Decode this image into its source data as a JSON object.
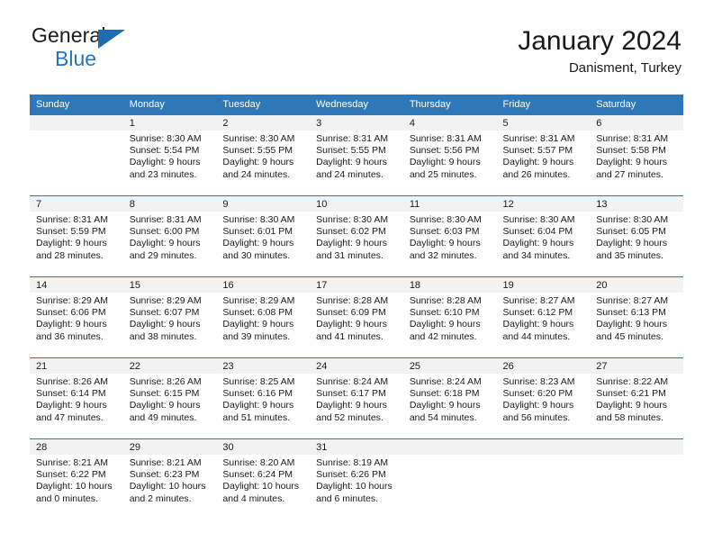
{
  "brand": {
    "name_part1": "General",
    "name_part2": "Blue"
  },
  "header": {
    "title": "January 2024",
    "subtitle": "Danisment, Turkey"
  },
  "colors": {
    "header_blue": "#3077b8",
    "brand_blue": "#1f77c4",
    "daynum_band": "#f2f2f2"
  },
  "weekdays": [
    "Sunday",
    "Monday",
    "Tuesday",
    "Wednesday",
    "Thursday",
    "Friday",
    "Saturday"
  ],
  "labels": {
    "sunrise_prefix": "Sunrise:",
    "sunset_prefix": "Sunset:",
    "daylight_prefix": "Daylight:"
  },
  "weeks": [
    [
      {
        "day": "",
        "empty": true
      },
      {
        "day": "1",
        "sunrise": "Sunrise: 8:30 AM",
        "sunset": "Sunset: 5:54 PM",
        "daylight": "Daylight: 9 hours and 23 minutes."
      },
      {
        "day": "2",
        "sunrise": "Sunrise: 8:30 AM",
        "sunset": "Sunset: 5:55 PM",
        "daylight": "Daylight: 9 hours and 24 minutes."
      },
      {
        "day": "3",
        "sunrise": "Sunrise: 8:31 AM",
        "sunset": "Sunset: 5:55 PM",
        "daylight": "Daylight: 9 hours and 24 minutes."
      },
      {
        "day": "4",
        "sunrise": "Sunrise: 8:31 AM",
        "sunset": "Sunset: 5:56 PM",
        "daylight": "Daylight: 9 hours and 25 minutes."
      },
      {
        "day": "5",
        "sunrise": "Sunrise: 8:31 AM",
        "sunset": "Sunset: 5:57 PM",
        "daylight": "Daylight: 9 hours and 26 minutes."
      },
      {
        "day": "6",
        "sunrise": "Sunrise: 8:31 AM",
        "sunset": "Sunset: 5:58 PM",
        "daylight": "Daylight: 9 hours and 27 minutes."
      }
    ],
    [
      {
        "day": "7",
        "sunrise": "Sunrise: 8:31 AM",
        "sunset": "Sunset: 5:59 PM",
        "daylight": "Daylight: 9 hours and 28 minutes."
      },
      {
        "day": "8",
        "sunrise": "Sunrise: 8:31 AM",
        "sunset": "Sunset: 6:00 PM",
        "daylight": "Daylight: 9 hours and 29 minutes."
      },
      {
        "day": "9",
        "sunrise": "Sunrise: 8:30 AM",
        "sunset": "Sunset: 6:01 PM",
        "daylight": "Daylight: 9 hours and 30 minutes."
      },
      {
        "day": "10",
        "sunrise": "Sunrise: 8:30 AM",
        "sunset": "Sunset: 6:02 PM",
        "daylight": "Daylight: 9 hours and 31 minutes."
      },
      {
        "day": "11",
        "sunrise": "Sunrise: 8:30 AM",
        "sunset": "Sunset: 6:03 PM",
        "daylight": "Daylight: 9 hours and 32 minutes."
      },
      {
        "day": "12",
        "sunrise": "Sunrise: 8:30 AM",
        "sunset": "Sunset: 6:04 PM",
        "daylight": "Daylight: 9 hours and 34 minutes."
      },
      {
        "day": "13",
        "sunrise": "Sunrise: 8:30 AM",
        "sunset": "Sunset: 6:05 PM",
        "daylight": "Daylight: 9 hours and 35 minutes."
      }
    ],
    [
      {
        "day": "14",
        "sunrise": "Sunrise: 8:29 AM",
        "sunset": "Sunset: 6:06 PM",
        "daylight": "Daylight: 9 hours and 36 minutes."
      },
      {
        "day": "15",
        "sunrise": "Sunrise: 8:29 AM",
        "sunset": "Sunset: 6:07 PM",
        "daylight": "Daylight: 9 hours and 38 minutes."
      },
      {
        "day": "16",
        "sunrise": "Sunrise: 8:29 AM",
        "sunset": "Sunset: 6:08 PM",
        "daylight": "Daylight: 9 hours and 39 minutes."
      },
      {
        "day": "17",
        "sunrise": "Sunrise: 8:28 AM",
        "sunset": "Sunset: 6:09 PM",
        "daylight": "Daylight: 9 hours and 41 minutes."
      },
      {
        "day": "18",
        "sunrise": "Sunrise: 8:28 AM",
        "sunset": "Sunset: 6:10 PM",
        "daylight": "Daylight: 9 hours and 42 minutes."
      },
      {
        "day": "19",
        "sunrise": "Sunrise: 8:27 AM",
        "sunset": "Sunset: 6:12 PM",
        "daylight": "Daylight: 9 hours and 44 minutes."
      },
      {
        "day": "20",
        "sunrise": "Sunrise: 8:27 AM",
        "sunset": "Sunset: 6:13 PM",
        "daylight": "Daylight: 9 hours and 45 minutes."
      }
    ],
    [
      {
        "day": "21",
        "sunrise": "Sunrise: 8:26 AM",
        "sunset": "Sunset: 6:14 PM",
        "daylight": "Daylight: 9 hours and 47 minutes."
      },
      {
        "day": "22",
        "sunrise": "Sunrise: 8:26 AM",
        "sunset": "Sunset: 6:15 PM",
        "daylight": "Daylight: 9 hours and 49 minutes."
      },
      {
        "day": "23",
        "sunrise": "Sunrise: 8:25 AM",
        "sunset": "Sunset: 6:16 PM",
        "daylight": "Daylight: 9 hours and 51 minutes."
      },
      {
        "day": "24",
        "sunrise": "Sunrise: 8:24 AM",
        "sunset": "Sunset: 6:17 PM",
        "daylight": "Daylight: 9 hours and 52 minutes."
      },
      {
        "day": "25",
        "sunrise": "Sunrise: 8:24 AM",
        "sunset": "Sunset: 6:18 PM",
        "daylight": "Daylight: 9 hours and 54 minutes."
      },
      {
        "day": "26",
        "sunrise": "Sunrise: 8:23 AM",
        "sunset": "Sunset: 6:20 PM",
        "daylight": "Daylight: 9 hours and 56 minutes."
      },
      {
        "day": "27",
        "sunrise": "Sunrise: 8:22 AM",
        "sunset": "Sunset: 6:21 PM",
        "daylight": "Daylight: 9 hours and 58 minutes."
      }
    ],
    [
      {
        "day": "28",
        "sunrise": "Sunrise: 8:21 AM",
        "sunset": "Sunset: 6:22 PM",
        "daylight": "Daylight: 10 hours and 0 minutes."
      },
      {
        "day": "29",
        "sunrise": "Sunrise: 8:21 AM",
        "sunset": "Sunset: 6:23 PM",
        "daylight": "Daylight: 10 hours and 2 minutes."
      },
      {
        "day": "30",
        "sunrise": "Sunrise: 8:20 AM",
        "sunset": "Sunset: 6:24 PM",
        "daylight": "Daylight: 10 hours and 4 minutes."
      },
      {
        "day": "31",
        "sunrise": "Sunrise: 8:19 AM",
        "sunset": "Sunset: 6:26 PM",
        "daylight": "Daylight: 10 hours and 6 minutes."
      },
      {
        "day": "",
        "empty": true
      },
      {
        "day": "",
        "empty": true
      },
      {
        "day": "",
        "empty": true
      }
    ]
  ]
}
